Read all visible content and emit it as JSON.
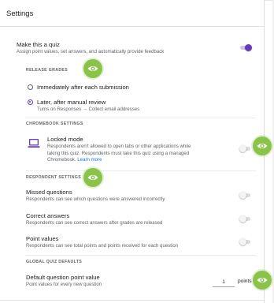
{
  "settings": {
    "title": "Settings"
  },
  "quiz": {
    "title": "Make this a quiz",
    "subtitle": "Assign point values, set answers, and automatically provide feedback",
    "enabled": true
  },
  "release_grades": {
    "caption": "RELEASE GRADES",
    "option_immediate": "Immediately after each submission",
    "option_later": "Later, after manual review",
    "option_later_sub": "Turns on Responses → Collect email addresses",
    "selected": "later"
  },
  "chromebook": {
    "caption": "CHROMEBOOK SETTINGS",
    "locked_title": "Locked mode",
    "locked_desc_1": "Respondents aren't allowed to open tabs or other applications while",
    "locked_desc_2": "taking this quiz. Respondents must take this quiz using a managed",
    "locked_desc_3": "Chromebook.",
    "learn_more": "Learn more",
    "enabled": false
  },
  "respondent": {
    "caption": "RESPONDENT SETTINGS",
    "missed_title": "Missed questions",
    "missed_sub": "Respondents can see which questions were answered incorrectly",
    "correct_title": "Correct answers",
    "correct_sub": "Respondents can see correct answers after grades are released",
    "points_title": "Point values",
    "points_sub": "Respondents can see total points and points received for each question"
  },
  "defaults": {
    "caption": "GLOBAL QUIZ DEFAULTS",
    "point_title": "Default question point value",
    "point_sub": "Point values for every new question",
    "point_value": "1",
    "points_unit": "points"
  },
  "icons": {
    "eye": "eye-icon",
    "laptop": "laptop-icon",
    "accent": "#673ab7",
    "highlight": "#8bc34a"
  }
}
